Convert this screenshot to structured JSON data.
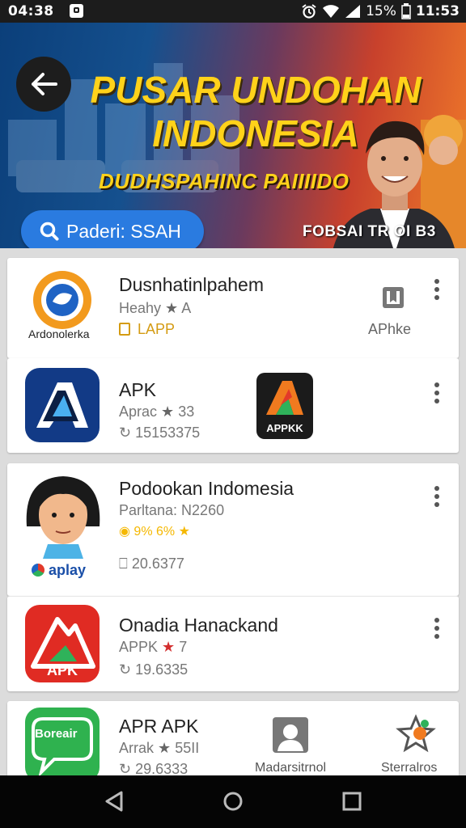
{
  "status_bar": {
    "time": "04:38",
    "battery": "15%",
    "clock": "11:53"
  },
  "banner": {
    "title_line1": "PUSAR UNDOHAN",
    "title_line2": "INDONESIA",
    "subtitle": "DUDHSPAHINC PAIIIIDO",
    "search_text": "Paderi: SSAH",
    "note": "FOBSAI TR OI B3"
  },
  "apps": [
    {
      "name": "Dusnhatinlpahem",
      "sub": "Heahy",
      "rating": "A",
      "meta": "LAPP",
      "icon_caption": "Ardonolerka",
      "side_label": "APhke"
    },
    {
      "name": "APK",
      "sub": "Aprac",
      "rating": "33",
      "meta": "15153375",
      "side_icon_text": "APPKK"
    },
    {
      "name": "Podookan Indomesia",
      "sub": "Parltana: N2260",
      "rating": "9% 6%",
      "meta": "20.6377",
      "icon_caption": "aplay"
    },
    {
      "name": "Onadia Hanackand",
      "sub": "APPK",
      "rating": "7",
      "meta": "19.6335",
      "icon_text": "APK"
    },
    {
      "name": "APR APK",
      "sub": "Arrak",
      "rating": "55II",
      "meta": "29.6333",
      "icon_text": "Boreair",
      "side1_label": "Madarsitrnol",
      "side2_label": "Sterralros"
    }
  ],
  "colors": {
    "accent": "#2a7be0",
    "title_yellow": "#ffd21a",
    "star_red": "#d32f2f",
    "star_gold": "#f5b800"
  }
}
